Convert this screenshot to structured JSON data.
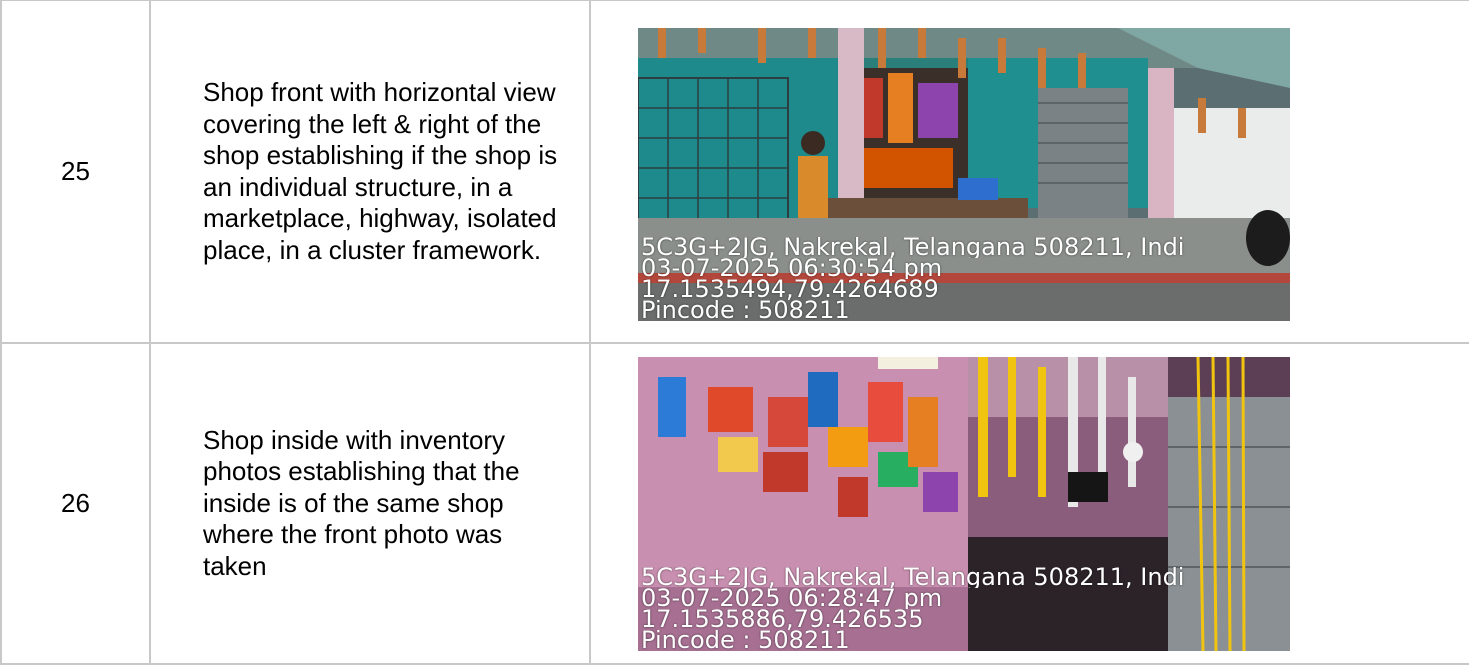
{
  "rows": [
    {
      "number": "25",
      "description": "Shop front with horizontal view covering the left & right of the shop establishing if the shop is an individual structure, in a marketplace, highway, isolated place, in a cluster framework.",
      "photo": {
        "subject": "shop-front",
        "stamp": {
          "address": "5C3G+2JG, Nakrekal, Telangana 508211, Indi",
          "datetime": "03-07-2025 06:30:54 pm",
          "coordinates": "17.1535494,79.4264689",
          "pincode": "Pincode : 508211"
        }
      }
    },
    {
      "number": "26",
      "description": "Shop inside with inventory photos establishing that the inside is of the same shop where the front photo was taken",
      "photo": {
        "subject": "shop-inside",
        "stamp": {
          "address": "5C3G+2JG, Nakrekal, Telangana 508211, Indi",
          "datetime": "03-07-2025 06:28:47 pm",
          "coordinates": "17.1535886,79.426535",
          "pincode": "Pincode : 508211"
        }
      }
    }
  ],
  "colors": {
    "border": "#c8c8c8",
    "stamp_text": "#ffffff",
    "shop_wall": "#1f8f8f",
    "pink_wall": "#c98fb0"
  }
}
